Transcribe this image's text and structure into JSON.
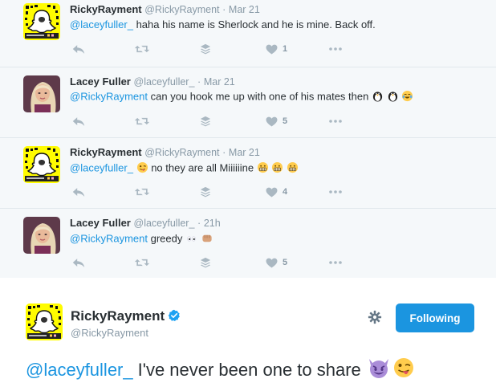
{
  "replies": [
    {
      "name": "RickyRayment",
      "handle": "@RickyRayment",
      "separator": "·",
      "time": "Mar 21",
      "mention": "@laceyfuller_",
      "text": "haha his name is Sherlock and he is mine. Back off.",
      "like_count": "1"
    },
    {
      "name": "Lacey Fuller",
      "handle": "@laceyfuller_",
      "separator": "·",
      "time": "Mar 21",
      "mention": "@RickyRayment",
      "text": "can you hook me up with one of his mates then",
      "like_count": "5"
    },
    {
      "name": "RickyRayment",
      "handle": "@RickyRayment",
      "separator": "·",
      "time": "Mar 21",
      "mention": "@laceyfuller_",
      "text": "no they are all Miiiiiine",
      "like_count": "4"
    },
    {
      "name": "Lacey Fuller",
      "handle": "@laceyfuller_",
      "separator": "·",
      "time": "21h",
      "mention": "@RickyRayment",
      "text": "greedy",
      "like_count": "5"
    }
  ],
  "main_tweet": {
    "name": "RickyRayment",
    "handle": "@RickyRayment",
    "follow_label": "Following",
    "mention": "@laceyfuller_",
    "text": "I've never been one to share"
  },
  "icons": {
    "reply": "reply-arrow-icon",
    "retweet": "retweet-icon",
    "moments": "layers-icon",
    "like": "heart-icon",
    "more": "more-dots-icon",
    "gear": "gear-icon",
    "verified": "verified-badge-icon"
  },
  "colors": {
    "link": "#1b95e0",
    "muted": "#8899a6",
    "icon": "#aab8c2",
    "follow_button": "#1b95e0",
    "thread_bg": "#f5f8fa",
    "snapcode_yellow": "#fffc00"
  }
}
